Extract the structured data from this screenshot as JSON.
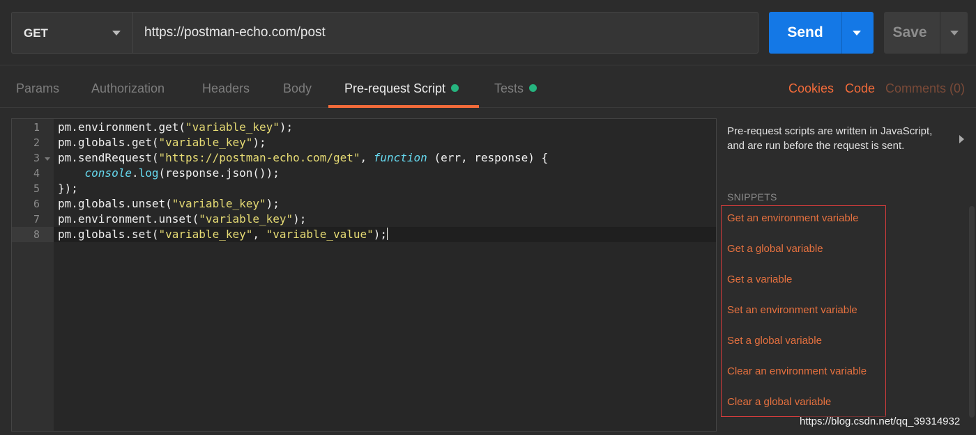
{
  "request": {
    "method": "GET",
    "url": "https://postman-echo.com/post",
    "send_label": "Send",
    "save_label": "Save"
  },
  "tabs": [
    {
      "label": "Params",
      "active": false
    },
    {
      "label": "Authorization",
      "active": false
    },
    {
      "label": "Headers",
      "active": false
    },
    {
      "label": "Body",
      "active": false
    },
    {
      "label": "Pre-request Script",
      "active": true,
      "has_dot": true
    },
    {
      "label": "Tests",
      "active": false,
      "has_dot": true
    }
  ],
  "right_links": {
    "cookies": "Cookies",
    "code": "Code",
    "comments": "Comments (0)"
  },
  "editor": {
    "line_numbers": [
      "1",
      "2",
      "3",
      "4",
      "5",
      "6",
      "7",
      "8"
    ],
    "active_line": 8
  },
  "side_panel": {
    "description": "Pre-request scripts are written in JavaScript, and are run before the request is sent.",
    "snippets_title": "SNIPPETS",
    "snippets": [
      "Get an environment variable",
      "Get a global variable",
      "Get a variable",
      "Set an environment variable",
      "Set a global variable",
      "Clear an environment variable",
      "Clear a global variable"
    ]
  },
  "watermark": "https://blog.csdn.net/qq_39314932",
  "colors": {
    "accent": "#f26b3a",
    "send": "#1478e6",
    "dot": "#26b47f",
    "snippet": "#e6713f"
  }
}
